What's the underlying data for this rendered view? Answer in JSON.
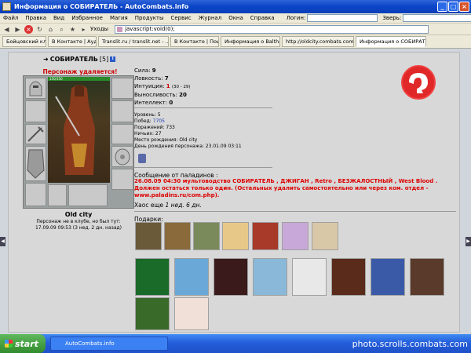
{
  "window": {
    "title": "Информация о СОБИРАТЕЛЬ - AutoCombats.info"
  },
  "menu": {
    "items": [
      "Файл",
      "Правка",
      "Вид",
      "Избранное",
      "Магия",
      "Продукты",
      "Сервис",
      "Журнал",
      "Окна",
      "Справка"
    ],
    "login_label": "Логин:",
    "beast_label": "Зверь:"
  },
  "nav": {
    "address": "javascript:void(0);",
    "go_label": "Уходы"
  },
  "tabs": [
    "Бойцовский клуб",
    "В Контакте | Аудио",
    "Translit.ru / translit.net - ...",
    "В Контакте | Поиск",
    "Информация о Balthazar",
    "http://oldcity.combats.com/lo...",
    "Информация о СОБИРАТЕЛЬ"
  ],
  "character": {
    "name": "СОБИРАТЕЛЬ",
    "level": "[5]",
    "removed_notice": "Персонаж удаляется!",
    "hp": "150/150",
    "city": "Old city",
    "last_seen": "Персонаж не в клубе, но был тут:",
    "last_seen_time": "17.09.09 09:53 (3 нед. 2 дн. назад)"
  },
  "stats": [
    {
      "label": "Сила:",
      "value": "9",
      "extra": ""
    },
    {
      "label": "Ловкость:",
      "value": "7",
      "extra": ""
    },
    {
      "label": "Интуиция:",
      "value": "1",
      "extra": "(30 - 29)"
    },
    {
      "label": "Выносливость:",
      "value": "20",
      "extra": ""
    },
    {
      "label": "Интеллект:",
      "value": "0",
      "extra": ""
    }
  ],
  "info": {
    "level": "Уровень: 5",
    "wins_label": "Побед:",
    "wins": "7705",
    "losses": "Поражений: 733",
    "draws": "Ничьих: 27",
    "birthplace": "Место рождения: Old city",
    "birthday": "День рождения персонажа: 23.01.09 03:11"
  },
  "message": {
    "header": "Сообщение от паладинов :",
    "body": "26.08.09 04:30 мультоводство СОБИРАТЕЛЬ , ДЖИГАН , Retro , БЕЗЖАЛОСТНЫЙ , West Blood . Должен остаться только один. (Остальных удалить самостоятельно или через ком. отдел - www.paladins.ru/com.php).",
    "chaos_prefix": "Хаос еще ",
    "chaos_value": "1 нед. 6 дн."
  },
  "gifts": {
    "header": "Подарки:"
  },
  "taskbar": {
    "start": "start",
    "task": "AutoCombats.info"
  },
  "watermark": "photo.scrolls.combats.com"
}
